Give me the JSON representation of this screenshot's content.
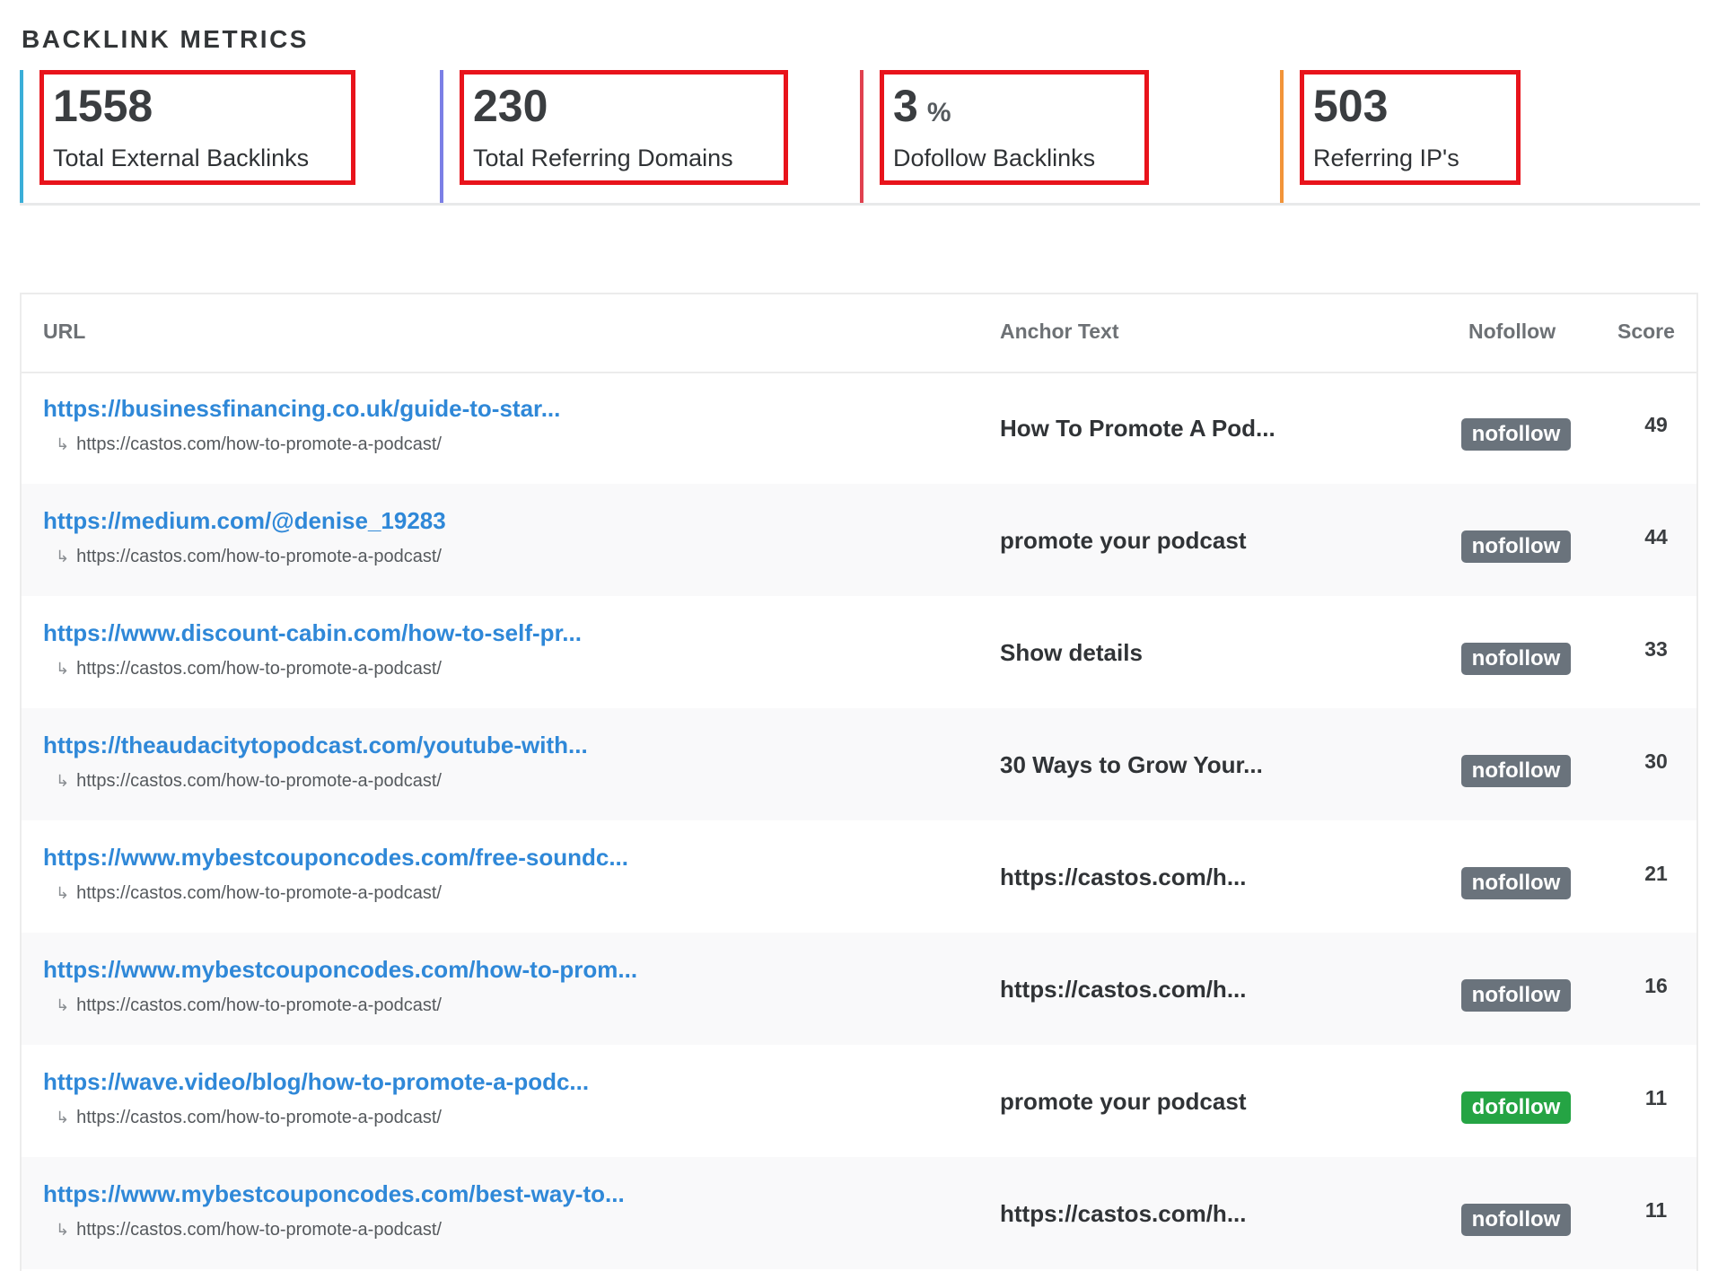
{
  "section_title": "BACKLINK METRICS",
  "colors": {
    "metric_borders": [
      "#3aaed8",
      "#7b7fe6",
      "#e0414f",
      "#f29439"
    ],
    "highlight_box": "#e8131b",
    "link": "#2f88d8",
    "badge_nofollow": "#6a737c",
    "badge_dofollow": "#25a444"
  },
  "metrics": [
    {
      "value": "1558",
      "unit": "",
      "label": "Total External Backlinks"
    },
    {
      "value": "230",
      "unit": "",
      "label": "Total Referring Domains"
    },
    {
      "value": "3",
      "unit": "%",
      "label": "Dofollow Backlinks"
    },
    {
      "value": "503",
      "unit": "",
      "label": "Referring IP's"
    }
  ],
  "table": {
    "headers": {
      "url": "URL",
      "anchor": "Anchor Text",
      "nofollow": "Nofollow",
      "score": "Score"
    },
    "arrow_icon": "↳",
    "rows": [
      {
        "url": "https://businessfinancing.co.uk/guide-to-star...",
        "target": "https://castos.com/how-to-promote-a-podcast/",
        "anchor": "How To Promote A Pod...",
        "follow": "nofollow",
        "score": "49"
      },
      {
        "url": "https://medium.com/@denise_19283",
        "target": "https://castos.com/how-to-promote-a-podcast/",
        "anchor": "promote your podcast",
        "follow": "nofollow",
        "score": "44"
      },
      {
        "url": "https://www.discount-cabin.com/how-to-self-pr...",
        "target": "https://castos.com/how-to-promote-a-podcast/",
        "anchor": "Show details",
        "follow": "nofollow",
        "score": "33"
      },
      {
        "url": "https://theaudacitytopodcast.com/youtube-with...",
        "target": "https://castos.com/how-to-promote-a-podcast/",
        "anchor": "30 Ways to Grow Your...",
        "follow": "nofollow",
        "score": "30"
      },
      {
        "url": "https://www.mybestcouponcodes.com/free-soundc...",
        "target": "https://castos.com/how-to-promote-a-podcast/",
        "anchor": "https://castos.com/h...",
        "follow": "nofollow",
        "score": "21"
      },
      {
        "url": "https://www.mybestcouponcodes.com/how-to-prom...",
        "target": "https://castos.com/how-to-promote-a-podcast/",
        "anchor": "https://castos.com/h...",
        "follow": "nofollow",
        "score": "16"
      },
      {
        "url": "https://wave.video/blog/how-to-promote-a-podc...",
        "target": "https://castos.com/how-to-promote-a-podcast/",
        "anchor": "promote your podcast",
        "follow": "dofollow",
        "score": "11"
      },
      {
        "url": "https://www.mybestcouponcodes.com/best-way-to...",
        "target": "https://castos.com/how-to-promote-a-podcast/",
        "anchor": "https://castos.com/h...",
        "follow": "nofollow",
        "score": "11"
      }
    ]
  }
}
